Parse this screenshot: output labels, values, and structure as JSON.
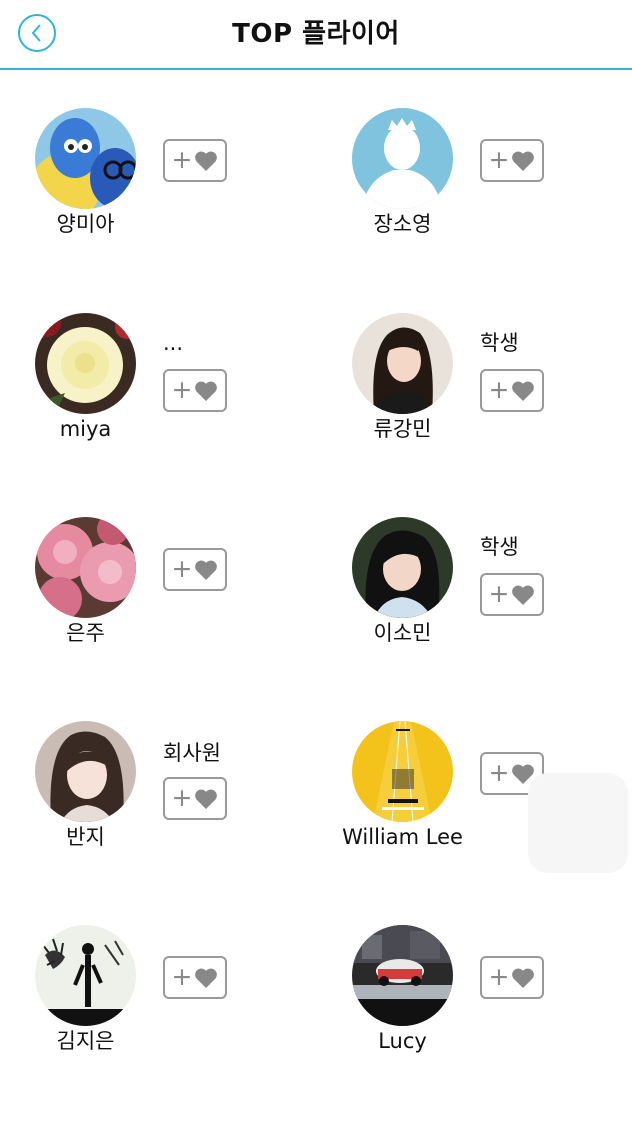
{
  "header": {
    "title": "TOP 플라이어",
    "accent": "#2eb6d6"
  },
  "players": [
    {
      "name": "양미아",
      "desc": "",
      "avatar": "inside-out-characters"
    },
    {
      "name": "장소영",
      "desc": "",
      "avatar": "default-silhouette"
    },
    {
      "name": "miya",
      "desc": "...",
      "avatar": "yellow-rose"
    },
    {
      "name": "류강민",
      "desc": "학생",
      "avatar": "woman-portrait"
    },
    {
      "name": "은주",
      "desc": "",
      "avatar": "pink-flowers"
    },
    {
      "name": "이소민",
      "desc": "학생",
      "avatar": "woman-portrait"
    },
    {
      "name": "반지",
      "desc": "회사원",
      "avatar": "woman-portrait"
    },
    {
      "name": "William Lee",
      "desc": "",
      "avatar": "yellow-road"
    },
    {
      "name": "김지은",
      "desc": "",
      "avatar": "silhouette-tree"
    },
    {
      "name": "Lucy",
      "desc": "",
      "avatar": "street-car"
    }
  ],
  "follow_button": {
    "plus": "+",
    "icon": "heart-icon"
  }
}
